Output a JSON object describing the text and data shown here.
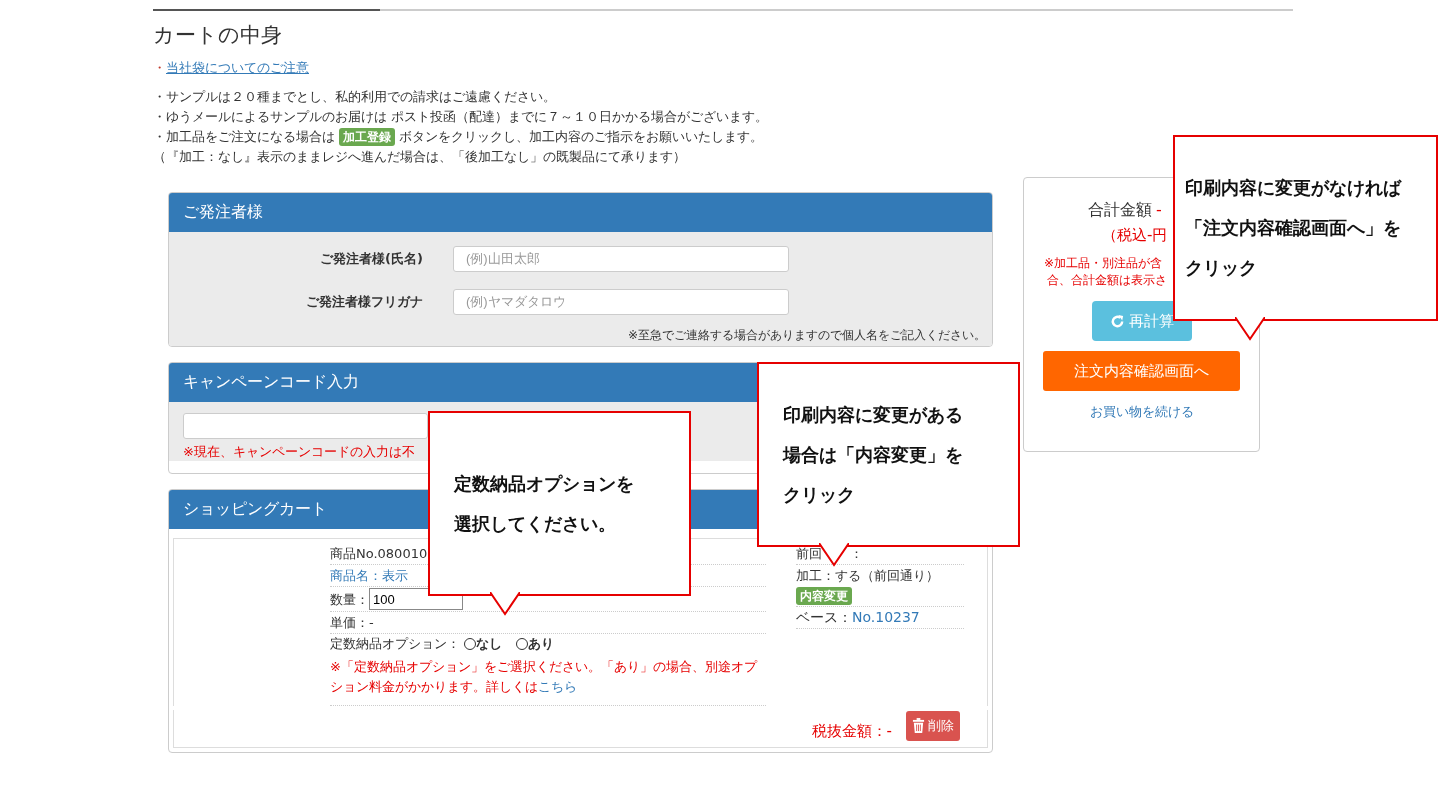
{
  "page": {
    "title": "カートの中身"
  },
  "notice": {
    "bullet": "・",
    "link": "当社袋についてのご注意"
  },
  "notes": [
    {
      "text": "・サンプルは２０種までとし、私的利用での請求はご遠慮ください。"
    },
    {
      "text": "・ゆうメールによるサンプルのお届けは ポスト投函（配達）までに７～１０日かかる場合がございます。"
    },
    {
      "before": "・加工品をご注文になる場合は",
      "badge": "加工登録",
      "after": "ボタンをクリックし、加工内容のご指示をお願いいたします。"
    },
    {
      "text": "（『加工：なし』表示のままレジへ進んだ場合は、「後加工なし」の既製品にて承ります）"
    }
  ],
  "orderer": {
    "heading": "ご発注者様",
    "fields": [
      {
        "label": "ご発注者様(氏名)",
        "placeholder": "(例)山田太郎"
      },
      {
        "label": "ご発注者様フリガナ",
        "placeholder": "(例)ヤマダタロウ"
      }
    ],
    "note": "※至急でご連絡する場合がありますので個人名をご記入ください。"
  },
  "campaign": {
    "heading": "キャンペーンコード入力",
    "note": "※現在、キャンペーンコードの入力は不"
  },
  "cart": {
    "heading": "ショッピングカート",
    "item": {
      "product_no": "商品No.080010",
      "product_name": "商品名：表示",
      "quantity_label": "数量：",
      "quantity": "100",
      "unit_price": "単価：-",
      "option_label": "定数納品オプション：",
      "options": [
        {
          "label": "なし",
          "selected": false
        },
        {
          "label": "あり",
          "selected": false
        }
      ],
      "option_note": "※「定数納品オプション」をご選択ください。「あり」の場合、別途オプション料金がかかります。詳しくは",
      "option_link": "こちら",
      "history_parts": [
        "前回",
        "："
      ],
      "processing": "加工：する（前回通り）",
      "change_badge": "内容変更",
      "base_label": "ベース：",
      "base_link": "No.10237",
      "subtotal": "税抜金額：-",
      "delete_button": "削除"
    }
  },
  "summary": {
    "total_label": "合計金額",
    "total_value": "-",
    "tax_line": "（税込-円",
    "notes": [
      "※加工品・別注品が含",
      "合、合計金額は表示さ"
    ],
    "recalc_button": "再計算",
    "confirm_button": "注文内容確認画面へ",
    "continue_link": "お買い物を続ける"
  },
  "callouts": [
    {
      "lines": [
        "定数納品オプションを",
        "選択してください。"
      ]
    },
    {
      "lines": [
        "印刷内容に変更がある",
        "場合は「内容変更」を",
        "クリック"
      ]
    },
    {
      "lines": [
        "印刷内容に変更がなければ",
        "「注文内容確認画面へ」を",
        "クリック"
      ]
    }
  ]
}
